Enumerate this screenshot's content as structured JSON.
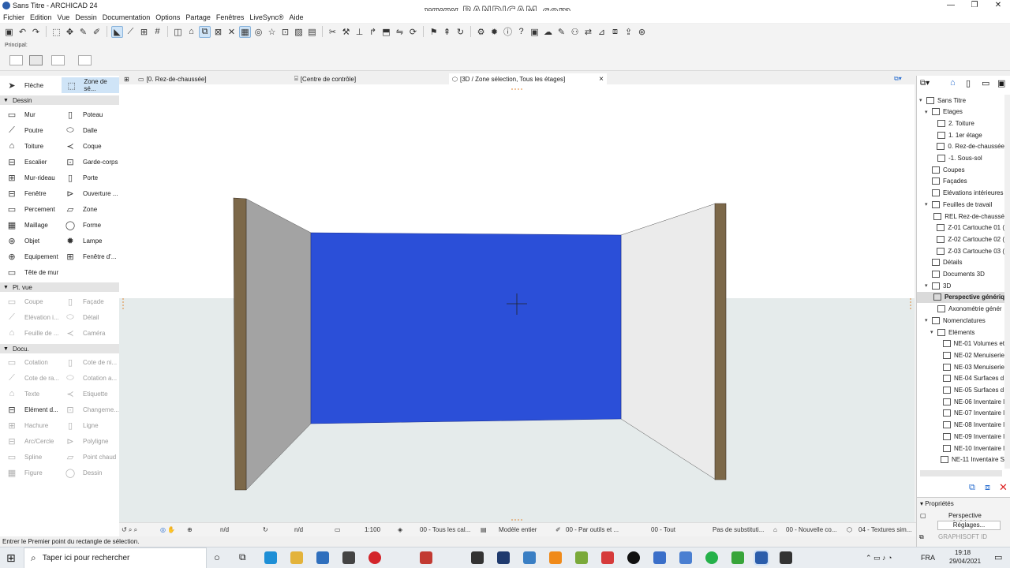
{
  "window": {
    "title": "Sans Titre - ARCHICAD 24",
    "buttons": [
      "—",
      "❐",
      "✕"
    ]
  },
  "watermark": "www.BANDICAM.com",
  "menu": [
    "Fichier",
    "Edition",
    "Vue",
    "Dessin",
    "Documentation",
    "Options",
    "Partage",
    "Fenêtres",
    "LiveSync®",
    "Aide"
  ],
  "principal_label": "Principal:",
  "toolbox": {
    "top": [
      {
        "label": "Flèche",
        "icon": "arrow-icon"
      },
      {
        "label": "Zone de sé...",
        "icon": "marquee-icon"
      }
    ],
    "sections": {
      "dessin": "Dessin",
      "ptvue": "Pt. vue",
      "docu": "Docu."
    },
    "dessin_tools": [
      [
        "Mur",
        "Poteau"
      ],
      [
        "Poutre",
        "Dalle"
      ],
      [
        "Toiture",
        "Coque"
      ],
      [
        "Escalier",
        "Garde-corps"
      ],
      [
        "Mur-rideau",
        "Porte"
      ],
      [
        "Fenêtre",
        "Ouverture ..."
      ],
      [
        "Percement",
        "Zone"
      ],
      [
        "Maillage",
        "Forme"
      ],
      [
        "Objet",
        "Lampe"
      ],
      [
        "Equipement",
        "Fenêtre d'..."
      ],
      [
        "Tête de mur",
        ""
      ]
    ],
    "ptvue_tools": [
      [
        "Coupe",
        "Façade"
      ],
      [
        "Elévation i...",
        "Détail"
      ],
      [
        "Feuille de ...",
        "Caméra"
      ]
    ],
    "docu_tools": [
      [
        "Cotation",
        "Cote de ni..."
      ],
      [
        "Cote de ra...",
        "Cotation a..."
      ],
      [
        "Texte",
        "Etiquette"
      ],
      [
        "Elément d...",
        "Changeme..."
      ],
      [
        "Hachure",
        "Ligne"
      ],
      [
        "Arc/Cercle",
        "Polyligne"
      ],
      [
        "Spline",
        "Point chaud"
      ],
      [
        "Figure",
        "Dessin"
      ]
    ]
  },
  "tabs": [
    {
      "label": "[0. Rez-de-chaussée]",
      "active": false
    },
    {
      "label": "[Centre de contrôle]",
      "active": false
    },
    {
      "label": "[3D / Zone sélection, Tous les étages]",
      "active": true
    }
  ],
  "tab_close": "×",
  "viewstatus": {
    "nd1": "n/d",
    "nd2": "n/d",
    "scale": "1:100",
    "layers": "00 - Tous les cal...",
    "model": "Modèle entier",
    "pens": "00 - Par outils et ...",
    "filter": "00 - Tout",
    "override": "Pas de substituti...",
    "renovation": "00 - Nouvelle co...",
    "textures": "04 - Textures sim..."
  },
  "statusline": "Entrer le Premier point du rectangle de sélection.",
  "navigator": {
    "rows": [
      {
        "label": "Sans Titre",
        "level": 0,
        "expand": "▾"
      },
      {
        "label": "Etages",
        "level": 1,
        "expand": "▾"
      },
      {
        "label": "2. Toiture",
        "level": 2,
        "expand": ""
      },
      {
        "label": "1. 1er étage",
        "level": 2,
        "expand": ""
      },
      {
        "label": "0. Rez-de-chaussée",
        "level": 2,
        "expand": ""
      },
      {
        "label": "-1. Sous-sol",
        "level": 2,
        "expand": ""
      },
      {
        "label": "Coupes",
        "level": 1,
        "expand": ""
      },
      {
        "label": "Façades",
        "level": 1,
        "expand": ""
      },
      {
        "label": "Elévations intérieures",
        "level": 1,
        "expand": ""
      },
      {
        "label": "Feuilles de travail",
        "level": 1,
        "expand": "▾"
      },
      {
        "label": "REL Rez-de-chaussé",
        "level": 2,
        "expand": ""
      },
      {
        "label": "Z-01 Cartouche 01 (",
        "level": 2,
        "expand": ""
      },
      {
        "label": "Z-02 Cartouche 02 (",
        "level": 2,
        "expand": ""
      },
      {
        "label": "Z-03 Cartouche 03 (",
        "level": 2,
        "expand": ""
      },
      {
        "label": "Détails",
        "level": 1,
        "expand": ""
      },
      {
        "label": "Documents 3D",
        "level": 1,
        "expand": ""
      },
      {
        "label": "3D",
        "level": 1,
        "expand": "▾"
      },
      {
        "label": "Perspective génériq",
        "level": 2,
        "expand": "",
        "selected": true
      },
      {
        "label": "Axonométrie génér",
        "level": 2,
        "expand": ""
      },
      {
        "label": "Nomenclatures",
        "level": 1,
        "expand": "▾"
      },
      {
        "label": "Eléments",
        "level": 2,
        "expand": "▾"
      },
      {
        "label": "NE-01 Volumes et",
        "level": 3,
        "expand": ""
      },
      {
        "label": "NE-02 Menuiserie",
        "level": 3,
        "expand": ""
      },
      {
        "label": "NE-03 Menuiserie",
        "level": 3,
        "expand": ""
      },
      {
        "label": "NE-04 Surfaces d",
        "level": 3,
        "expand": ""
      },
      {
        "label": "NE-05 Surfaces d",
        "level": 3,
        "expand": ""
      },
      {
        "label": "NE-06 Inventaire l",
        "level": 3,
        "expand": ""
      },
      {
        "label": "NE-07 Inventaire l",
        "level": 3,
        "expand": ""
      },
      {
        "label": "NE-08 Inventaire l",
        "level": 3,
        "expand": ""
      },
      {
        "label": "NE-09 Inventaire l",
        "level": 3,
        "expand": ""
      },
      {
        "label": "NE-10 Inventaire l",
        "level": 3,
        "expand": ""
      },
      {
        "label": "NE-11 Inventaire S",
        "level": 3,
        "expand": ""
      }
    ],
    "props_title": "Propriétés",
    "props_view": "Perspective générique",
    "props_settings": "Réglages...",
    "brand": "GRAPHISOFT ID"
  },
  "taskbar": {
    "search_placeholder": "Taper ici pour rechercher",
    "lang": "FRA",
    "time": "19:18",
    "date": "29/04/2021"
  },
  "colors": {
    "wall_blue": "#2b4fd8",
    "ground": "#e5ebeb",
    "accent": "#cfe4f7"
  }
}
